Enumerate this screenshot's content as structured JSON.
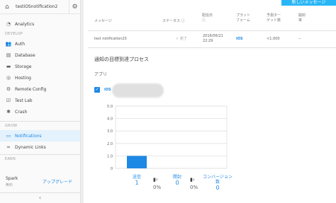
{
  "sidebar": {
    "project_name": "testiOSnotification2",
    "sections": {
      "analytics": "Analytics",
      "develop_label": "DEVELOP",
      "grow_label": "GROW",
      "earn_label": "EARN"
    },
    "develop_items": [
      "Auth",
      "Database",
      "Storage",
      "Hosting",
      "Remote Config",
      "Test Lab",
      "Crash"
    ],
    "grow_items": [
      "Notifications",
      "Dynamic Links"
    ],
    "plan_name": "Spark",
    "plan_type": "無料",
    "upgrade_label": "アップグレード",
    "collapse_icon": "‹"
  },
  "header": {
    "new_message_button": "新しいメッセージ"
  },
  "table": {
    "headers": {
      "message": "メッセージ",
      "status": "ステータス",
      "delivery_date": "配信日",
      "platform": "プラットフォーム",
      "target_count": "予測ターゲット数",
      "open_rate": "開封率"
    },
    "row": {
      "message": "test notification20",
      "status": "完了",
      "delivery_date": "2016/06/21 22:29",
      "platform": "iOS",
      "target_count": "<1,000",
      "open_rate": "--"
    }
  },
  "process": {
    "title": "通知の目標到達プロセス",
    "app_label": "アプリ",
    "platform_badge": "iOS"
  },
  "chart_data": {
    "type": "bar",
    "categories": [
      "送信",
      "開封",
      "コンバージョン数"
    ],
    "values": [
      1,
      0,
      0
    ],
    "ylim": [
      0,
      5
    ],
    "yticks": [
      "0",
      "1.0",
      "2.0",
      "3.0",
      "4.0",
      "5.0"
    ],
    "grid": true,
    "bar_color": "#1e88e5"
  },
  "stats": {
    "sent_label": "送信",
    "sent_value": "1",
    "open_label": "開封",
    "open_value": "0",
    "open_pct": "0%",
    "conv_label_1": "コンバージョン",
    "conv_label_2": "数",
    "conv_value": "0",
    "conv_pct": "0%"
  }
}
